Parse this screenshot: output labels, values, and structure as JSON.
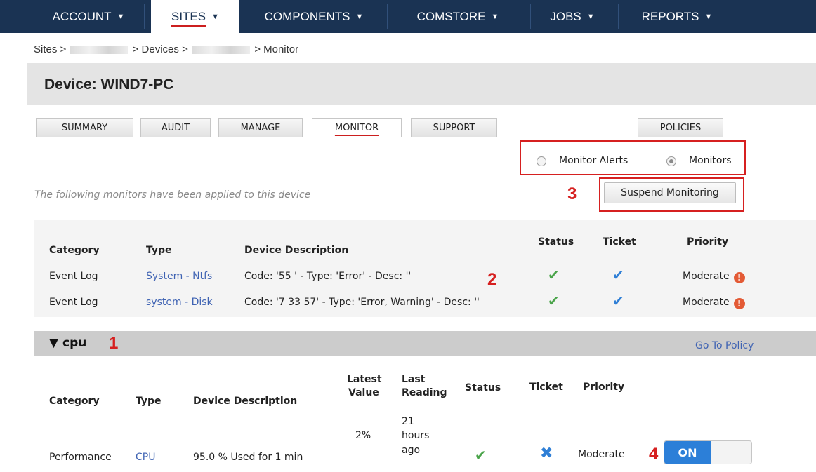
{
  "nav": {
    "items": [
      {
        "label": "ACCOUNT",
        "caret": "▼"
      },
      {
        "label": "SITES",
        "caret": "▼"
      },
      {
        "label": "COMPONENTS",
        "caret": "▼"
      },
      {
        "label": "COMSTORE",
        "caret": "▼"
      },
      {
        "label": "JOBS",
        "caret": "▼"
      },
      {
        "label": "REPORTS",
        "caret": "▼"
      }
    ],
    "active": "SITES"
  },
  "breadcrumb": {
    "sites": "Sites >",
    "after_site": "> Devices >",
    "current": "> Monitor"
  },
  "device": {
    "title": "Device: WIND7-PC"
  },
  "tabs": [
    {
      "label": "SUMMARY"
    },
    {
      "label": "AUDIT"
    },
    {
      "label": "MANAGE"
    },
    {
      "label": "MONITOR"
    },
    {
      "label": "SUPPORT"
    },
    {
      "label": "POLICIES"
    }
  ],
  "view_toggle": {
    "options": [
      "Monitor Alerts",
      "Monitors"
    ],
    "selected": "Monitors"
  },
  "note": "The following monitors have been applied to this device",
  "suspend_label": "Suspend Monitoring",
  "annotations": [
    "1",
    "2",
    "3",
    "4"
  ],
  "table1": {
    "headers": {
      "category": "Category",
      "type": "Type",
      "description": "Device Description",
      "status": "Status",
      "ticket": "Ticket",
      "priority": "Priority"
    },
    "rows": [
      {
        "category": "Event Log",
        "type": "System - Ntfs",
        "description": "Code: '55 ' - Type: 'Error' - Desc: ''",
        "priority": "Moderate"
      },
      {
        "category": "Event Log",
        "type": "system - Disk",
        "description": "Code: '7 33 57' - Type: 'Error, Warning' - Desc: ''",
        "priority": "Moderate"
      }
    ]
  },
  "policy_section": {
    "title": "▼ cpu",
    "goto_label": "Go To Policy"
  },
  "table2": {
    "headers": {
      "category": "Category",
      "type": "Type",
      "description": "Device Description",
      "latest_value_1": "Latest",
      "latest_value_2": "Value",
      "last_reading_1": "Last",
      "last_reading_2": "Reading",
      "status": "Status",
      "ticket": "Ticket",
      "priority": "Priority"
    },
    "row": {
      "category": "Performance",
      "type": "CPU",
      "description": "95.0 % Used for 1 min",
      "latest_value": "2%",
      "last_reading_1": "21",
      "last_reading_2": "hours",
      "last_reading_3": "ago",
      "priority": "Moderate",
      "toggle": "ON"
    }
  },
  "icons": {
    "status_ok": "green-check-icon",
    "ticket_ok": "blue-check-icon",
    "ticket_none": "blue-x-icon",
    "priority": "alert-icon"
  },
  "colors": {
    "nav_bg": "#1a3353",
    "annotation": "#d62020",
    "link": "#3f63b3",
    "toggle_on": "#2c7fd8"
  }
}
